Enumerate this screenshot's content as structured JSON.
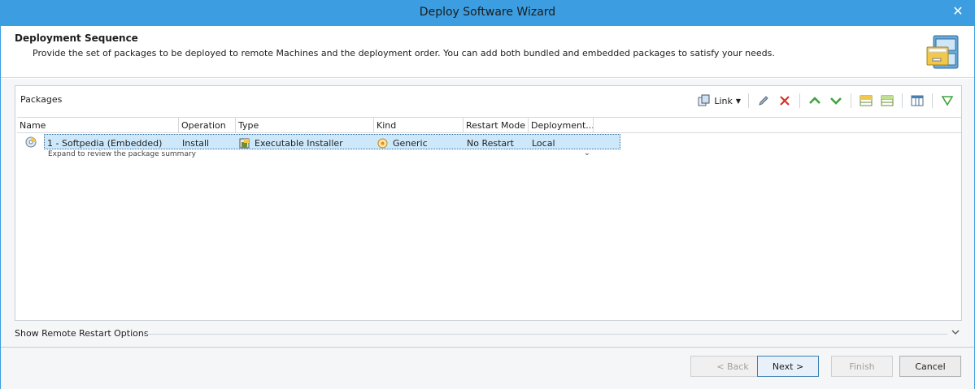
{
  "window": {
    "title": "Deploy Software Wizard",
    "close_glyph": "✕"
  },
  "header": {
    "title": "Deployment Sequence",
    "description": "Provide the set of packages to be deployed to remote Machines and the deployment order. You can add both bundled and embedded packages to satisfy your needs."
  },
  "packages": {
    "label": "Packages",
    "toolbar": {
      "link_label": "Link",
      "icons": [
        "link-icon",
        "edit-icon",
        "delete-icon",
        "move-up-icon",
        "move-down-icon",
        "group-icon",
        "ungroup-icon",
        "columns-icon",
        "filter-icon"
      ]
    },
    "columns": [
      "Name",
      "Operation",
      "Type",
      "Kind",
      "Restart Mode",
      "Deployment..."
    ],
    "rows": [
      {
        "name": "1 - Softpedia (Embedded)",
        "operation": "Install",
        "type": "Executable Installer",
        "kind": "Generic",
        "restart_mode": "No Restart",
        "deployment": "Local",
        "summary": "Expand to review the package summary"
      }
    ]
  },
  "restart_options": {
    "label": "Show Remote Restart Options"
  },
  "footer": {
    "back": "< Back",
    "next": "Next >",
    "finish": "Finish",
    "cancel": "Cancel"
  },
  "colors": {
    "titlebar": "#3c9de0",
    "selection": "#cde8fb",
    "accent_green": "#3fa33f",
    "delete_red": "#d9322b"
  }
}
